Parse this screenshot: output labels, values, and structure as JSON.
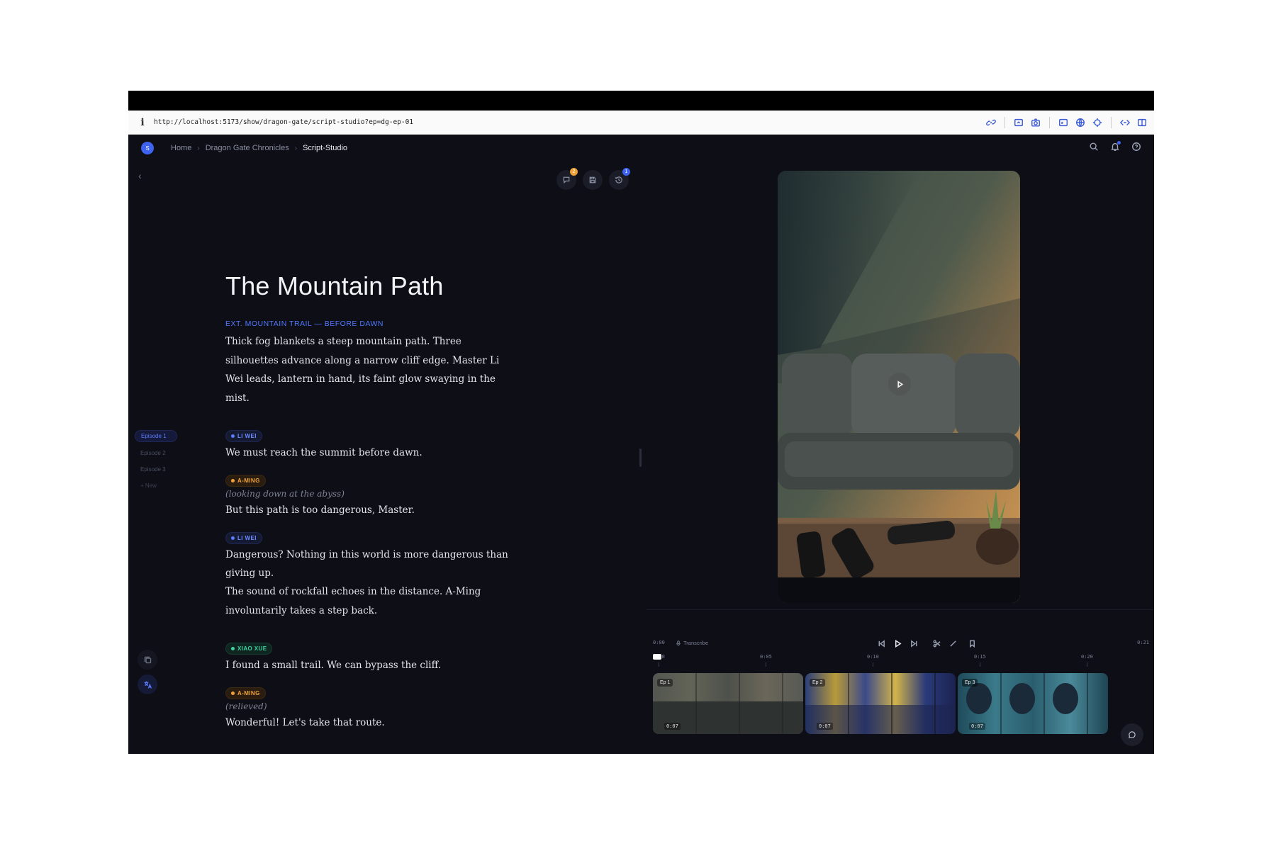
{
  "browser": {
    "url": "http://localhost:5173/show/dragon-gate/script-studio?ep=dg-ep-01",
    "info_glyph": "i",
    "toolbar_icons": [
      "link-icon",
      "screenshot-region-icon",
      "camera-icon",
      "terminal-icon",
      "globe-icon",
      "crosshair-icon",
      "code-icon",
      "split-view-icon"
    ]
  },
  "header": {
    "avatar_letter": "S",
    "breadcrumbs": [
      "Home",
      "Dragon Gate Chronicles",
      "Script-Studio"
    ],
    "icons": [
      "search-icon",
      "bell-icon",
      "help-icon"
    ],
    "accent_color": "#3d63f0"
  },
  "sidebar": {
    "back_glyph": "‹",
    "episodes": [
      "Episode 1",
      "Episode 2",
      "Episode 3"
    ],
    "new_label": "+ New",
    "active_episode": "Episode 1"
  },
  "editor_tools": {
    "comments_badge": "2",
    "history_badge": "1"
  },
  "script": {
    "title": "The Mountain Path",
    "scene_heading": "EXT. MOUNTAIN TRAIL — BEFORE DAWN",
    "action_1": "Thick fog blankets a steep mountain path. Three silhouettes advance along a narrow cliff edge. Master Li Wei leads, lantern in hand, its faint glow swaying in the mist.",
    "blocks": [
      {
        "character": "LI WEI",
        "color": "blue",
        "parenthetical": "",
        "line": "We must reach the summit before dawn."
      },
      {
        "character": "A-MING",
        "color": "orange",
        "parenthetical": "(looking down at the abyss)",
        "line": "But this path is too dangerous, Master."
      },
      {
        "character": "LI WEI",
        "color": "blue",
        "parenthetical": "",
        "line": "Dangerous? Nothing in this world is more dangerous than giving up."
      }
    ],
    "action_2": "The sound of rockfall echoes in the distance. A-Ming involuntarily takes a step back.",
    "blocks_2": [
      {
        "character": "XIAO XUE",
        "color": "green",
        "parenthetical": "",
        "line": "I found a small trail. We can bypass the cliff."
      },
      {
        "character": "A-MING",
        "color": "orange",
        "parenthetical": "(relieved)",
        "line": "Wonderful! Let's take that route."
      }
    ]
  },
  "timeline": {
    "current_time": "0:00",
    "total_time": "0:21",
    "transcribe_label": "Transcribe",
    "ruler_ticks": [
      "0:00",
      "0:05",
      "0:10",
      "0:15",
      "0:20"
    ],
    "playhead_label": "00",
    "clips": [
      {
        "label": "Ep 1",
        "duration": "0:07"
      },
      {
        "label": "Ep 2",
        "duration": "0:07"
      },
      {
        "label": "Ep 3",
        "duration": "0:07"
      }
    ]
  }
}
